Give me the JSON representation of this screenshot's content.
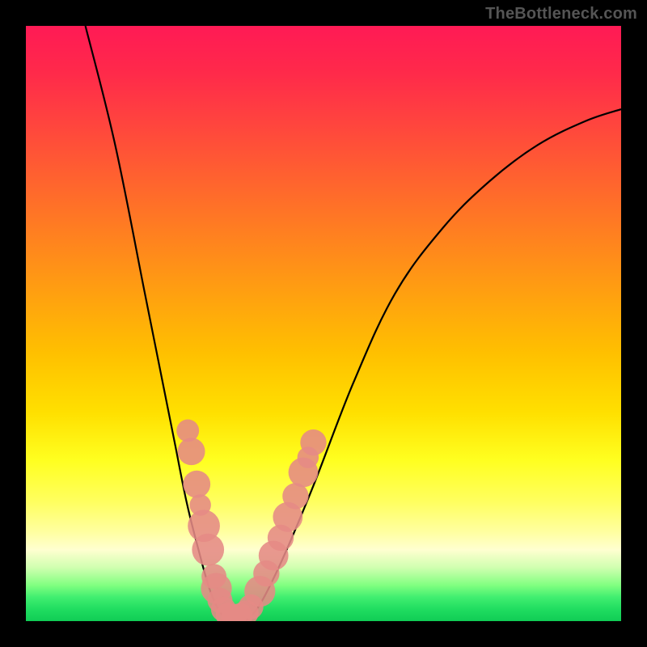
{
  "watermark": "TheBottleneck.com",
  "chart_data": {
    "type": "line",
    "title": "",
    "xlabel": "",
    "ylabel": "",
    "xlim": [
      0,
      100
    ],
    "ylim": [
      0,
      100
    ],
    "series": [
      {
        "name": "bottleneck-curve",
        "x": [
          10,
          15,
          20,
          23,
          25,
          27,
          29,
          31,
          33,
          35,
          38,
          42,
          48,
          55,
          62,
          70,
          78,
          86,
          94,
          100
        ],
        "y": [
          100,
          80,
          55,
          40,
          30,
          20,
          12,
          5,
          1,
          0,
          1,
          8,
          22,
          40,
          55,
          66,
          74,
          80,
          84,
          86
        ]
      }
    ],
    "markers": [
      {
        "x": 27.2,
        "y": 32.0,
        "r": 1.9
      },
      {
        "x": 27.8,
        "y": 28.5,
        "r": 2.3
      },
      {
        "x": 28.7,
        "y": 23.0,
        "r": 2.3
      },
      {
        "x": 29.3,
        "y": 19.5,
        "r": 1.8
      },
      {
        "x": 29.9,
        "y": 16.0,
        "r": 2.7
      },
      {
        "x": 30.6,
        "y": 12.0,
        "r": 2.7
      },
      {
        "x": 31.6,
        "y": 7.5,
        "r": 2.1
      },
      {
        "x": 32.0,
        "y": 5.5,
        "r": 2.6
      },
      {
        "x": 32.6,
        "y": 3.5,
        "r": 2.1
      },
      {
        "x": 33.2,
        "y": 2.0,
        "r": 2.1
      },
      {
        "x": 34.0,
        "y": 1.0,
        "r": 2.1
      },
      {
        "x": 35.0,
        "y": 0.8,
        "r": 2.1
      },
      {
        "x": 36.0,
        "y": 0.9,
        "r": 2.1
      },
      {
        "x": 37.0,
        "y": 1.4,
        "r": 2.1
      },
      {
        "x": 37.8,
        "y": 2.4,
        "r": 2.1
      },
      {
        "x": 39.3,
        "y": 5.0,
        "r": 2.6
      },
      {
        "x": 40.4,
        "y": 8.0,
        "r": 2.2
      },
      {
        "x": 41.6,
        "y": 11.0,
        "r": 2.5
      },
      {
        "x": 42.8,
        "y": 14.0,
        "r": 2.2
      },
      {
        "x": 44.0,
        "y": 17.5,
        "r": 2.5
      },
      {
        "x": 45.3,
        "y": 21.0,
        "r": 2.2
      },
      {
        "x": 46.6,
        "y": 25.0,
        "r": 2.5
      },
      {
        "x": 47.4,
        "y": 27.5,
        "r": 1.8
      },
      {
        "x": 48.3,
        "y": 30.0,
        "r": 2.2
      }
    ],
    "marker_color": "#e58a85",
    "curve_color": "#000000",
    "gradient_stops": [
      {
        "pct": 0,
        "color": "#ff1a55"
      },
      {
        "pct": 50,
        "color": "#ffc000"
      },
      {
        "pct": 88,
        "color": "#ffffd0"
      },
      {
        "pct": 100,
        "color": "#10cc55"
      }
    ]
  }
}
